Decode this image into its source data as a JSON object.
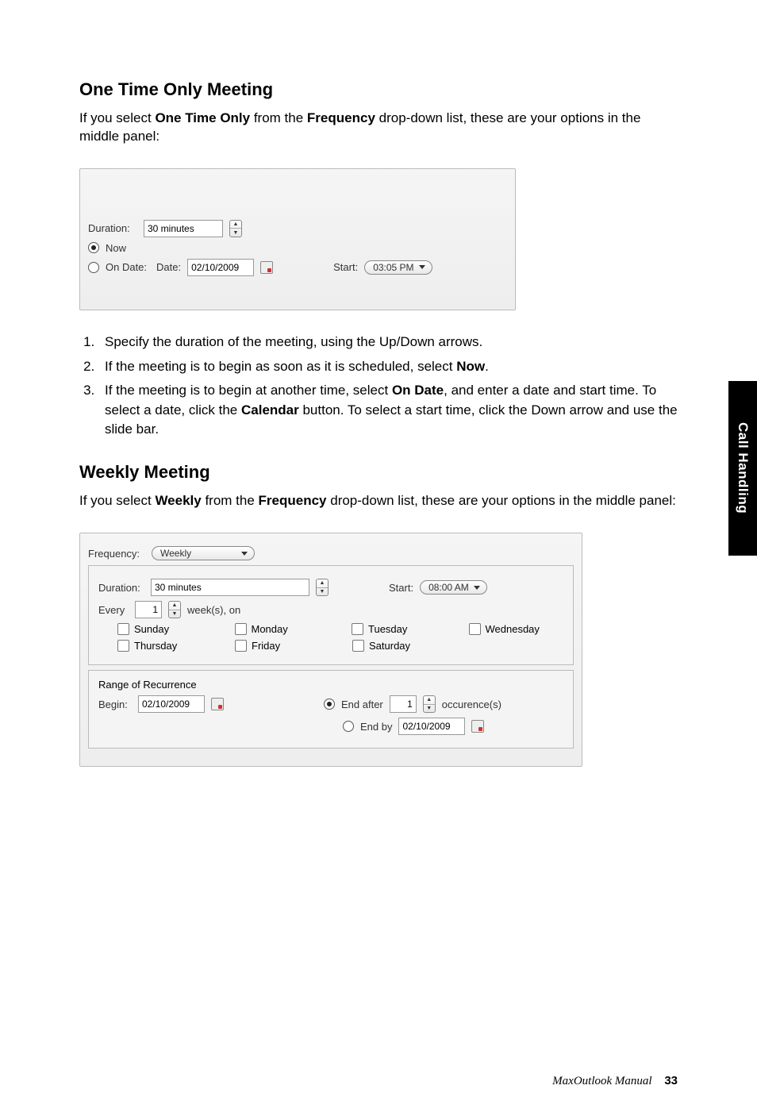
{
  "sideTab": "Call Handling",
  "section1": {
    "heading": "One Time Only Meeting",
    "para_pre": "If you select ",
    "para_b1": "One Time Only",
    "para_mid": " from the ",
    "para_b2": "Frequency",
    "para_post": " drop-down list, these are your options in the middle panel:"
  },
  "panel1": {
    "durationLabel": "Duration:",
    "durationValue": "30 minutes",
    "nowLabel": "Now",
    "onDateLabel": "On Date:",
    "dateLabel": "Date:",
    "dateValue": "02/10/2009",
    "startLabel": "Start:",
    "startValue": "03:05 PM"
  },
  "steps1": {
    "s1": "Specify the duration of the meeting, using the Up/Down arrows.",
    "s2_pre": "If the meeting is to begin as soon as it is scheduled, select ",
    "s2_b": "Now",
    "s2_post": ".",
    "s3_pre": "If the meeting is to begin at another time, select ",
    "s3_b1": "On Date",
    "s3_mid": ", and enter a date and start time. To select a date, click the ",
    "s3_b2": "Calendar",
    "s3_post": " button. To select a start time, click the Down arrow and use the slide bar."
  },
  "section2": {
    "heading": "Weekly Meeting",
    "para_pre": "If you select ",
    "para_b1": "Weekly",
    "para_mid": " from the ",
    "para_b2": "Frequency",
    "para_post": " drop-down list, these are your options in the middle panel:"
  },
  "panel2": {
    "frequencyLabel": "Frequency:",
    "frequencyValue": "Weekly",
    "durationLabel": "Duration:",
    "durationValue": "30 minutes",
    "startLabel": "Start:",
    "startValue": "08:00 AM",
    "everyLabel": "Every",
    "everyValue": "1",
    "weeksOn": "week(s), on",
    "days": {
      "sun": "Sunday",
      "mon": "Monday",
      "tue": "Tuesday",
      "wed": "Wednesday",
      "thu": "Thursday",
      "fri": "Friday",
      "sat": "Saturday"
    },
    "rangeTitle": "Range of Recurrence",
    "beginLabel": "Begin:",
    "beginValue": "02/10/2009",
    "endAfterLabel": "End after",
    "endAfterValue": "1",
    "occLabel": "occurence(s)",
    "endByLabel": "End by",
    "endByValue": "02/10/2009"
  },
  "footer": {
    "title": "MaxOutlook Manual",
    "page": "33"
  }
}
